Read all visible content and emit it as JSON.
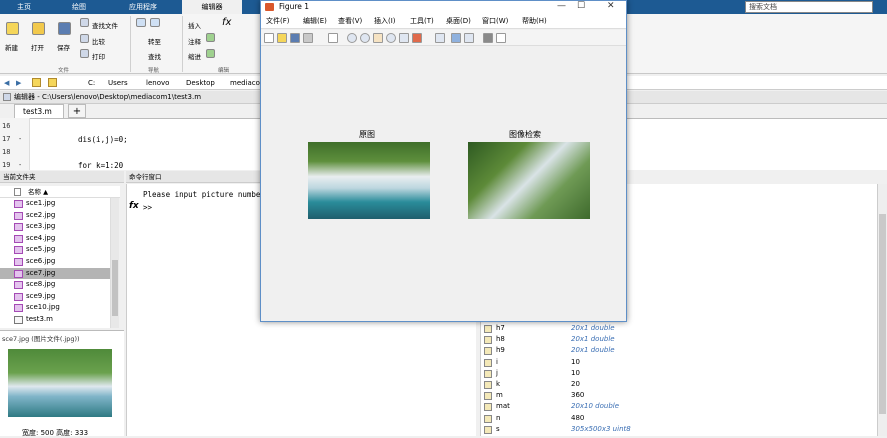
{
  "tabs": {
    "home": "主页",
    "plots": "绘图",
    "apps": "应用程序",
    "editor": "编辑器"
  },
  "ribbon": {
    "new": "新建",
    "open": "打开",
    "save": "保存",
    "find_files": "查找文件",
    "compare": "比较",
    "print": "打印",
    "goto": "转至",
    "find": "查找",
    "insert": "插入",
    "comment": "注释",
    "indent": "缩进",
    "group_file": "文件",
    "group_nav": "导航",
    "group_edit": "编辑"
  },
  "search": {
    "placeholder": "搜索文档"
  },
  "address": {
    "path": [
      "C:",
      "Users",
      "lenovo",
      "Desktop",
      "mediaco"
    ]
  },
  "editor": {
    "title": "编辑器 - C:\\Users\\lenovo\\Desktop\\mediacom1\\test3.m",
    "tab": "test3.m",
    "add_tab": "+",
    "lines": [
      {
        "n": "16",
        "mark": "",
        "code": ""
      },
      {
        "n": "17",
        "mark": "-",
        "code": "dis(i,j)=0;"
      },
      {
        "n": "18",
        "mark": "",
        "code": ""
      },
      {
        "n": "19",
        "mark": "-",
        "code": "for k=1:20"
      }
    ]
  },
  "current_folder": {
    "title": "当前文件夹",
    "col_name": "名称 ▲",
    "files": [
      "sce1.jpg",
      "sce2.jpg",
      "sce3.jpg",
      "sce4.jpg",
      "sce5.jpg",
      "sce6.jpg",
      "sce7.jpg",
      "sce8.jpg",
      "sce9.jpg",
      "sce10.jpg",
      "test3.m"
    ],
    "selected_index": 6,
    "preview_label": "sce7.jpg (图片文件(.jpg))",
    "dimensions": "宽度: 500  高度: 333"
  },
  "command_window": {
    "title": "命令行窗口",
    "output": "Please input picture number",
    "prompt": ">>",
    "fx": "fx"
  },
  "workspace": {
    "rows": [
      {
        "name": "h7",
        "value": "20x1 double",
        "italic": true
      },
      {
        "name": "h8",
        "value": "20x1 double",
        "italic": true
      },
      {
        "name": "h9",
        "value": "20x1 double",
        "italic": true
      },
      {
        "name": "i",
        "value": "10",
        "italic": false
      },
      {
        "name": "j",
        "value": "10",
        "italic": false
      },
      {
        "name": "k",
        "value": "20",
        "italic": false
      },
      {
        "name": "m",
        "value": "360",
        "italic": false
      },
      {
        "name": "mat",
        "value": "20x10 double",
        "italic": true
      },
      {
        "name": "n",
        "value": "480",
        "italic": false
      },
      {
        "name": "s",
        "value": "305x500x3 uint8",
        "italic": true
      }
    ]
  },
  "figure": {
    "title": "Figure 1",
    "menu": [
      "文件(F)",
      "编辑(E)",
      "查看(V)",
      "插入(I)",
      "工具(T)",
      "桌面(D)",
      "窗口(W)",
      "帮助(H)"
    ],
    "minimize": "—",
    "maximize": "☐",
    "close": "✕",
    "axis1_title": "原图",
    "axis2_title": "图像检索"
  },
  "colors": {
    "accent": "#1d5a93",
    "selection": "#b4b4b4",
    "link": "#3b6fb4"
  }
}
